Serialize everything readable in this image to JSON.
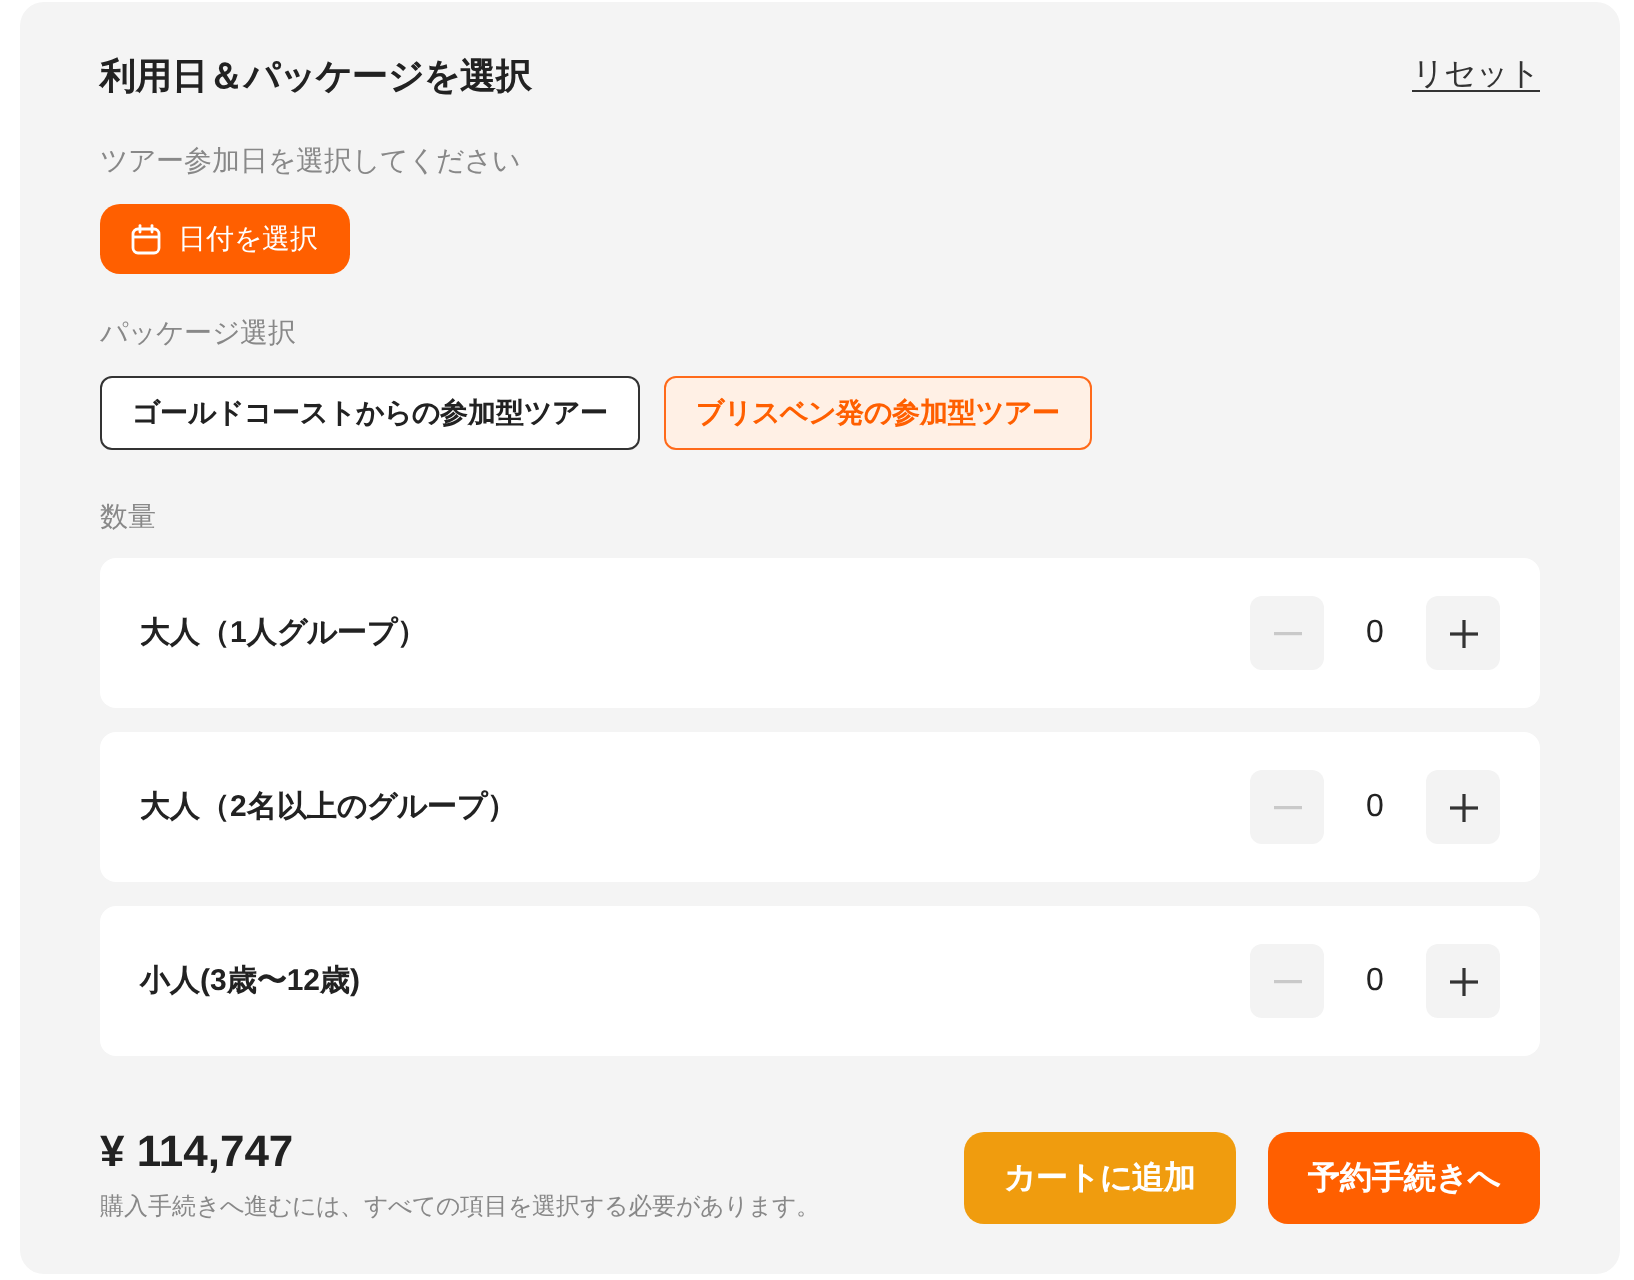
{
  "header": {
    "title": "利用日＆パッケージを選択",
    "reset_link": "リセット"
  },
  "date": {
    "label": "ツアー参加日を選択してください",
    "button": "日付を選択"
  },
  "packages": {
    "label": "パッケージ選択",
    "options": [
      {
        "label": "ゴールドコーストからの参加型ツアー",
        "selected": false
      },
      {
        "label": "ブリスベン発の参加型ツアー",
        "selected": true
      }
    ]
  },
  "quantity": {
    "label": "数量",
    "items": [
      {
        "name": "大人（1人グループ）",
        "value": "0",
        "decrement_disabled": true,
        "increment_disabled": false
      },
      {
        "name": "大人（2名以上のグループ）",
        "value": "0",
        "decrement_disabled": true,
        "increment_disabled": false
      },
      {
        "name": "小人(3歳〜12歳)",
        "value": "0",
        "decrement_disabled": true,
        "increment_disabled": false
      }
    ]
  },
  "footer": {
    "price": "¥ 114,747",
    "note": "購入手続きへ進むには、すべての項目を選択する必要があります。",
    "buttons": [
      {
        "label": "カートに追加",
        "kind": "secondary"
      },
      {
        "label": "予約手続きへ",
        "kind": "primary"
      }
    ]
  }
}
